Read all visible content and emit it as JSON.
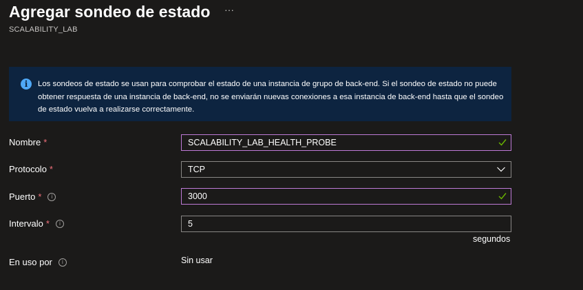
{
  "header": {
    "title": "Agregar sondeo de estado",
    "more_label": "···",
    "subtitle": "SCALABILITY_LAB"
  },
  "info": {
    "icon": "info-icon",
    "text": "Los sondeos de estado se usan para comprobar el estado de una instancia de grupo de back-end. Si el sondeo de estado no puede obtener respuesta de una instancia de back-end, no se enviarán nuevas conexiones a esa instancia de back-end hasta que el sondeo de estado vuelva a realizarse correctamente."
  },
  "form": {
    "name": {
      "label": "Nombre",
      "required": "*",
      "value": "SCALABILITY_LAB_HEALTH_PROBE"
    },
    "protocol": {
      "label": "Protocolo",
      "required": "*",
      "value": "TCP"
    },
    "port": {
      "label": "Puerto",
      "required": "*",
      "value": "3000"
    },
    "interval": {
      "label": "Intervalo",
      "required": "*",
      "value": "5",
      "units": "segundos"
    },
    "in_use": {
      "label": "En uso por",
      "value": "Sin usar"
    }
  },
  "colors": {
    "background": "#1b1a19",
    "banner": "#0d2440",
    "valid_border": "#c07bd8",
    "required": "#f1707b",
    "check": "#6bb700"
  }
}
